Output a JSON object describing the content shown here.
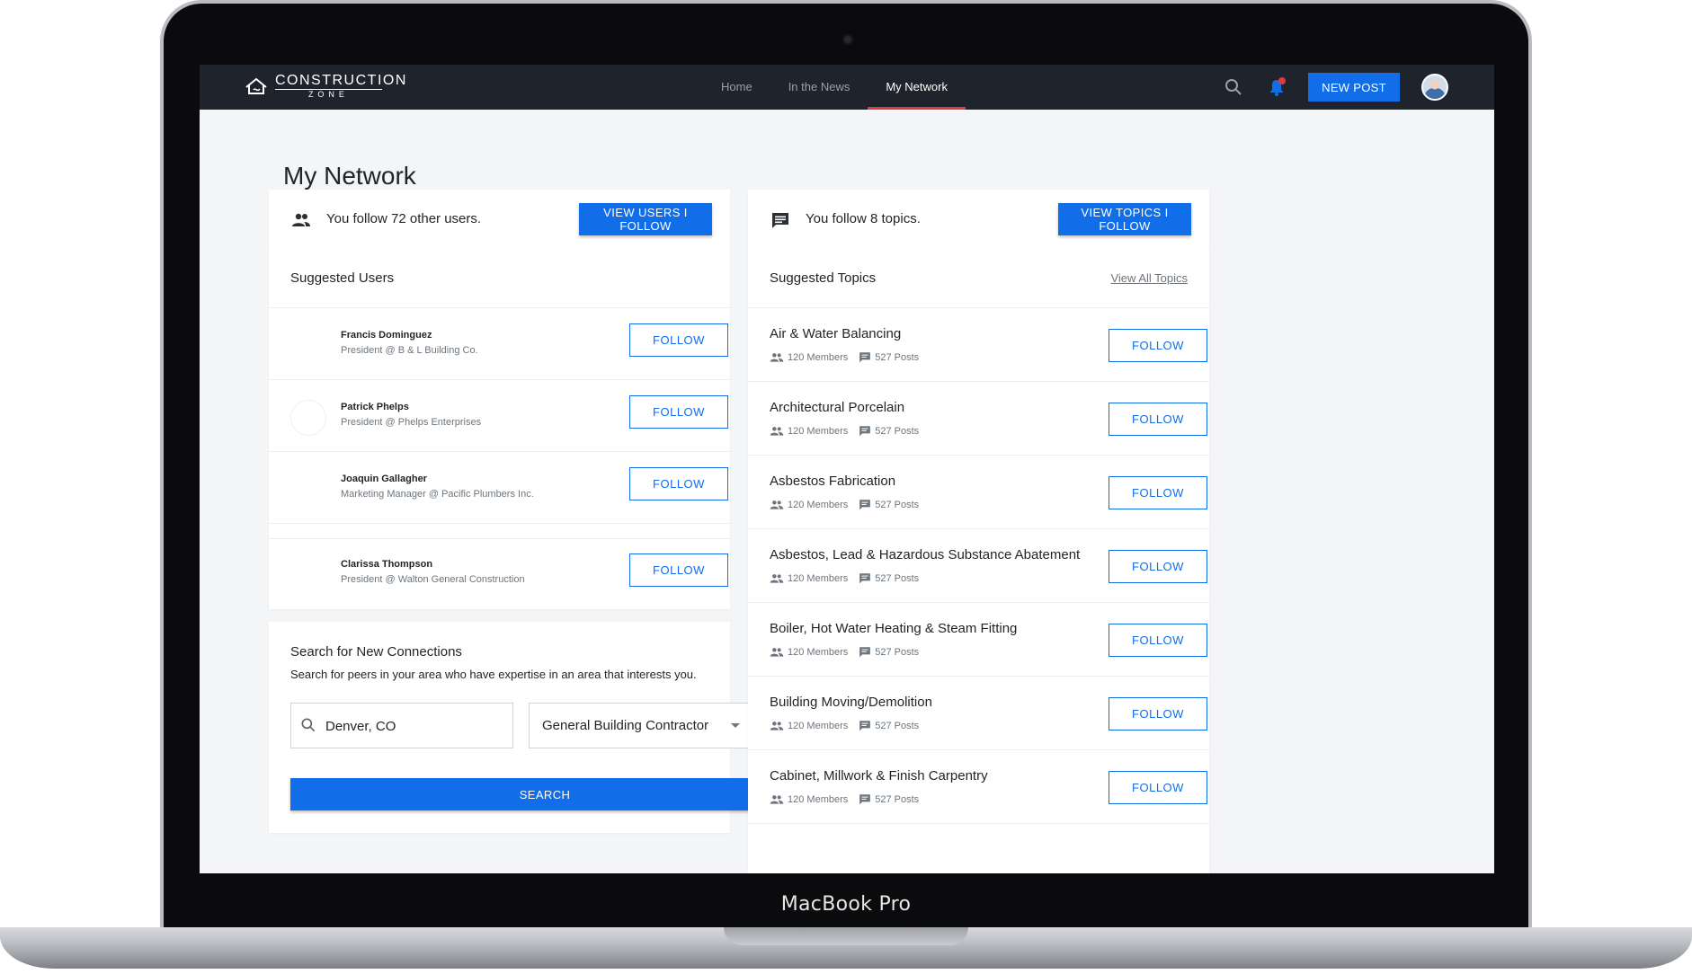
{
  "device": {
    "label": "MacBook Pro"
  },
  "brand": {
    "name": "CONSTRUCTION",
    "sub": "ZONE",
    "accent": "#116de8",
    "active_tab_color": "#e03a3e"
  },
  "nav": {
    "links": [
      {
        "label": "Home",
        "active": false
      },
      {
        "label": "In the News",
        "active": false
      },
      {
        "label": "My Network",
        "active": true
      }
    ],
    "search_icon": "search-icon",
    "notification_icon": "bell-icon",
    "new_post_label": "NEW POST"
  },
  "page": {
    "title": "My Network"
  },
  "following_users": {
    "text": "You follow 72 other users.",
    "button": "VIEW USERS I FOLLOW",
    "icon": "people-icon"
  },
  "following_topics": {
    "text": "You follow 8 topics.",
    "button": "VIEW TOPICS I FOLLOW",
    "icon": "chat-icon"
  },
  "suggested_users": {
    "title": "Suggested Users",
    "follow_label": "FOLLOW",
    "items": [
      {
        "name": "Francis Dominguez",
        "role": "President @ B & L Building Co."
      },
      {
        "name": "Patrick Phelps",
        "role": "President @ Phelps Enterprises"
      },
      {
        "name": "Joaquin Gallagher",
        "role": "Marketing Manager @ Pacific Plumbers Inc."
      },
      {
        "name": "Clarissa Thompson",
        "role": "President @ Walton General Construction"
      }
    ]
  },
  "suggested_topics": {
    "title": "Suggested Topics",
    "view_all": "View All Topics",
    "follow_label": "FOLLOW",
    "items": [
      {
        "name": "Air & Water Balancing",
        "members": "120 Members",
        "posts": "527 Posts"
      },
      {
        "name": "Architectural Porcelain",
        "members": "120 Members",
        "posts": "527 Posts"
      },
      {
        "name": "Asbestos Fabrication",
        "members": "120 Members",
        "posts": "527 Posts"
      },
      {
        "name": "Asbestos, Lead & Hazardous Substance Abatement",
        "members": "120 Members",
        "posts": "527 Posts"
      },
      {
        "name": "Boiler, Hot Water Heating & Steam Fitting",
        "members": "120 Members",
        "posts": "527 Posts"
      },
      {
        "name": "Building Moving/Demolition",
        "members": "120 Members",
        "posts": "527 Posts"
      },
      {
        "name": "Cabinet, Millwork & Finish Carpentry",
        "members": "120 Members",
        "posts": "527 Posts"
      }
    ]
  },
  "search_connections": {
    "title": "Search for New Connections",
    "description": "Search for peers in your area who have expertise in an area that interests you.",
    "location_value": "Denver, CO",
    "trade_value": "General Building Contractor",
    "button": "SEARCH"
  }
}
